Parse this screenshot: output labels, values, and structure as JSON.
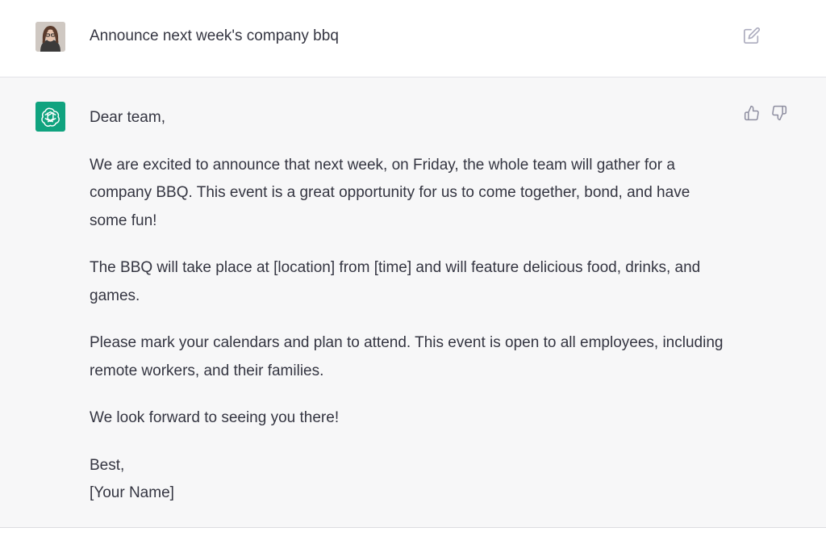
{
  "user_message": {
    "avatar": "user-avatar-photo",
    "text": "Announce next week's company bbq",
    "edit_icon": "pencil-square-icon"
  },
  "assistant_message": {
    "avatar": "openai-logo-icon",
    "accent_color": "#10a37f",
    "paragraphs": [
      "Dear team,",
      "We are excited to announce that next week, on Friday, the whole team will gather for a company BBQ. This event is a great opportunity for us to come together, bond, and have some fun!",
      "The BBQ will take place at [location] from [time] and will feature delicious food, drinks, and games.",
      "Please mark your calendars and plan to attend. This event is open to all employees, including remote workers, and their families.",
      "We look forward to seeing you there!"
    ],
    "closing": "Best,",
    "signature": "[Your Name]",
    "feedback_icons": [
      "thumbs-up-icon",
      "thumbs-down-icon"
    ]
  }
}
